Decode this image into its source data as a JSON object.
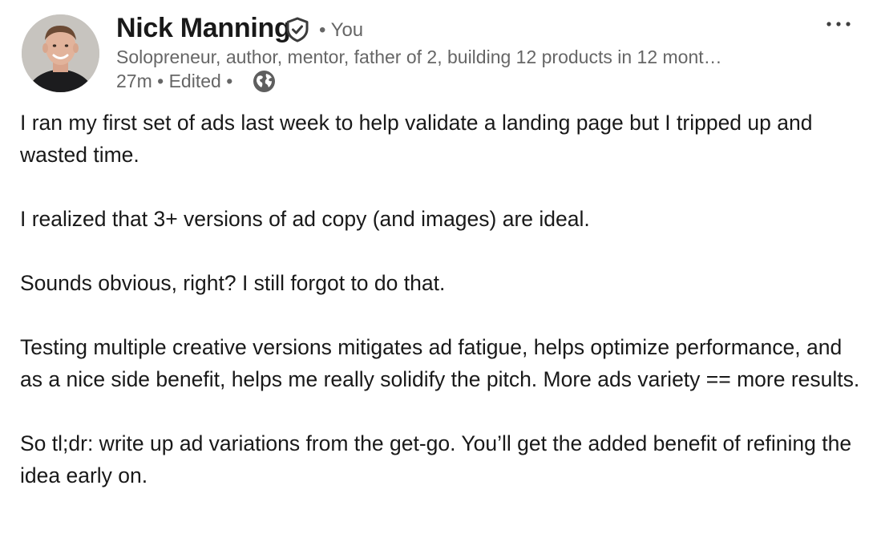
{
  "author": {
    "name": "Nick Manning",
    "relation": "• You",
    "headline": "Solopreneur, author, mentor, father of 2, building 12 products in 12 mont…",
    "time": "27m",
    "edited": "Edited",
    "separator": "•",
    "visibility_icon": "globe-icon",
    "verified_icon": "verified-shield-icon",
    "avatar_alt": "Nick Manning"
  },
  "menu": {
    "icon": "more-options-icon"
  },
  "post": {
    "paragraphs": [
      "I ran my first set of ads last week to help validate a landing page but I tripped up and wasted time.",
      "I realized that 3+ versions of ad copy (and images) are ideal.",
      "Sounds obvious, right? I still forgot to do that.",
      "Testing multiple creative versions mitigates ad fatigue, helps optimize performance, and as a nice side benefit, helps me really solidify the pitch. More ads variety == more results.",
      "So tl;dr: write up ad variations from the get-go. You’ll get the added benefit of refining the idea early on."
    ]
  },
  "colors": {
    "text_primary": "#191919",
    "text_secondary": "#666666",
    "background": "#ffffff"
  }
}
